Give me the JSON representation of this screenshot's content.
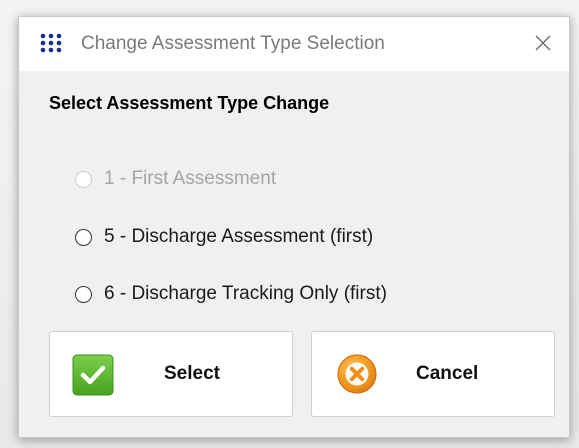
{
  "window": {
    "title": "Change Assessment Type Selection",
    "app_icon": "dots-grid-icon",
    "close_icon": "close-icon"
  },
  "heading": "Select Assessment Type Change",
  "options": [
    {
      "label": "1 - First Assessment",
      "enabled": false,
      "selected": false
    },
    {
      "label": "5 - Discharge Assessment (first)",
      "enabled": true,
      "selected": false
    },
    {
      "label": "6 - Discharge Tracking Only (first)",
      "enabled": true,
      "selected": false
    }
  ],
  "buttons": {
    "select_label": "Select",
    "select_icon": "checkmark-icon",
    "cancel_label": "Cancel",
    "cancel_icon": "cancel-x-icon"
  },
  "colors": {
    "select_green": "#5cb82c",
    "cancel_orange": "#f0921c",
    "app_icon_blue": "#1a2a8c"
  }
}
